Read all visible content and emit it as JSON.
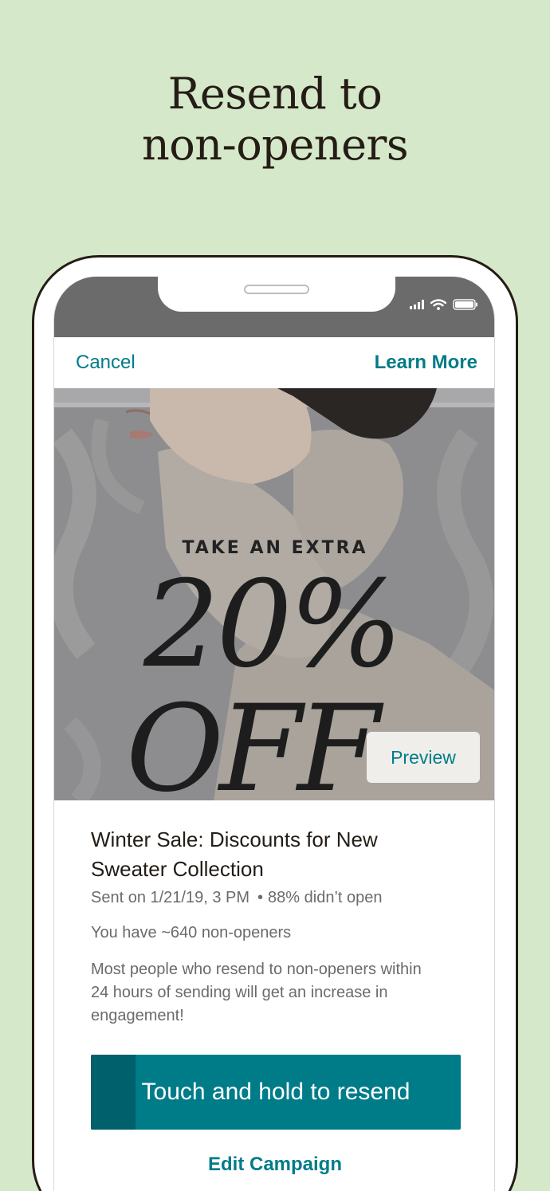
{
  "headline": {
    "line1": "Resend to",
    "line2": "non-openers"
  },
  "colors": {
    "background": "#d5e8c9",
    "accent": "#007c89",
    "accent_dark": "#00606b",
    "ink": "#241c15"
  },
  "status_icons": [
    "cellular-signal-icon",
    "wifi-icon",
    "battery-icon"
  ],
  "nav": {
    "cancel": "Cancel",
    "learn_more": "Learn More"
  },
  "hero": {
    "line1": "TAKE AN EXTRA",
    "line2": "20%",
    "line3": "OFF",
    "preview": "Preview"
  },
  "campaign": {
    "title": "Winter Sale: Discounts for New Sweater Collection",
    "sent": "Sent on 1/21/19, 3 PM",
    "open_stat": "88% didn’t open",
    "nonopeners": "You have ~640 non-openers",
    "hint": "Most people who resend to non-openers within 24 hours of sending will get an increase in engagement!"
  },
  "resend_button": {
    "label": "Touch and hold to resend",
    "progress": 0.12
  },
  "edit_campaign": "Edit Campaign"
}
